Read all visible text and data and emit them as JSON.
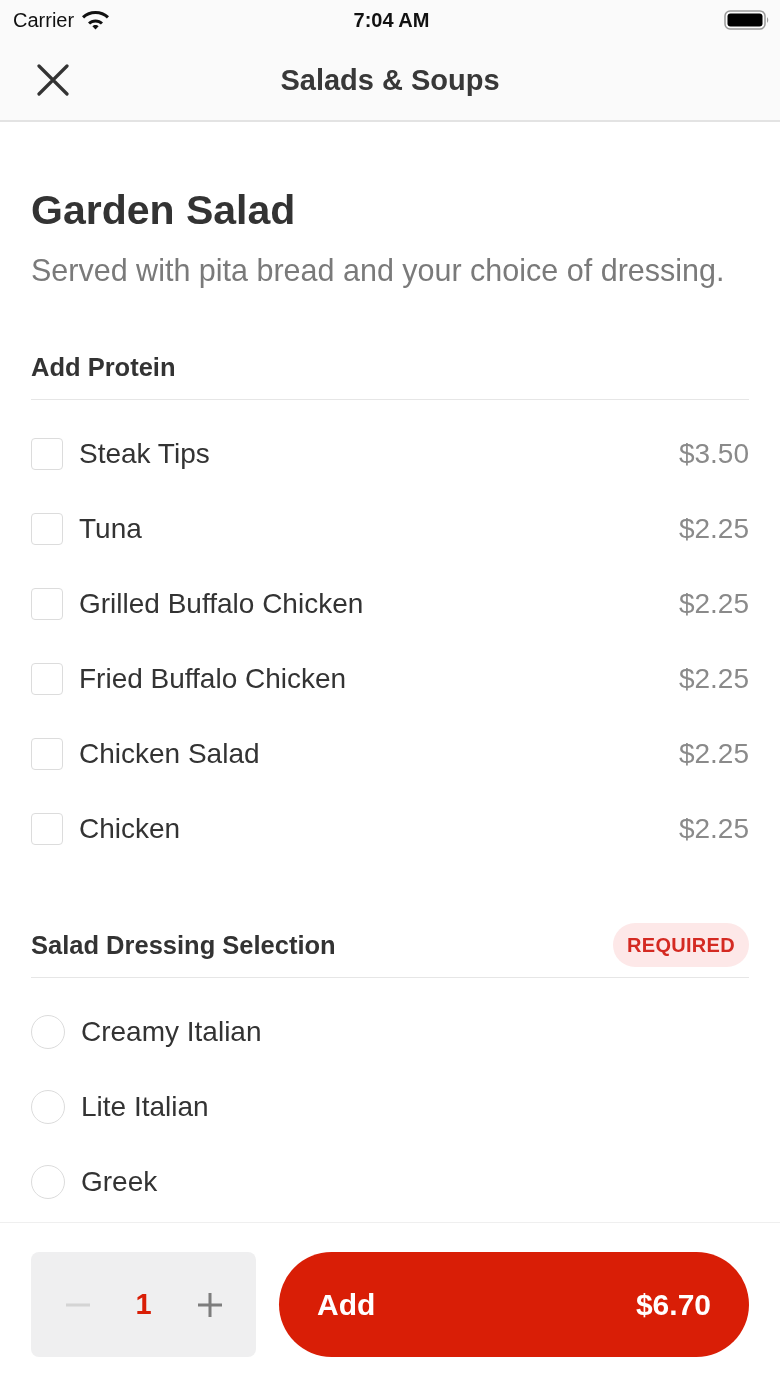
{
  "status_bar": {
    "carrier": "Carrier",
    "time": "7:04 AM"
  },
  "nav": {
    "title": "Salads & Soups"
  },
  "item": {
    "name": "Garden Salad",
    "description": "Served with pita bread and your choice of dressing."
  },
  "sections": [
    {
      "title": "Add Protein",
      "kind": "checkbox",
      "options": [
        {
          "label": "Steak Tips",
          "price": "$3.50",
          "checked": false
        },
        {
          "label": "Tuna",
          "price": "$2.25",
          "checked": false
        },
        {
          "label": "Grilled Buffalo Chicken",
          "price": "$2.25",
          "checked": false
        },
        {
          "label": "Fried Buffalo Chicken",
          "price": "$2.25",
          "checked": false
        },
        {
          "label": "Chicken Salad",
          "price": "$2.25",
          "checked": false
        },
        {
          "label": "Chicken",
          "price": "$2.25",
          "checked": false
        }
      ]
    },
    {
      "title": "Salad Dressing Selection",
      "badge": "REQUIRED",
      "kind": "radio",
      "options": [
        {
          "label": "Creamy Italian",
          "selected": false
        },
        {
          "label": "Lite Italian",
          "selected": false
        },
        {
          "label": "Greek",
          "selected": false
        }
      ]
    }
  ],
  "footer": {
    "quantity": "1",
    "decrement_disabled": true,
    "add_label": "Add",
    "total": "$6.70"
  }
}
